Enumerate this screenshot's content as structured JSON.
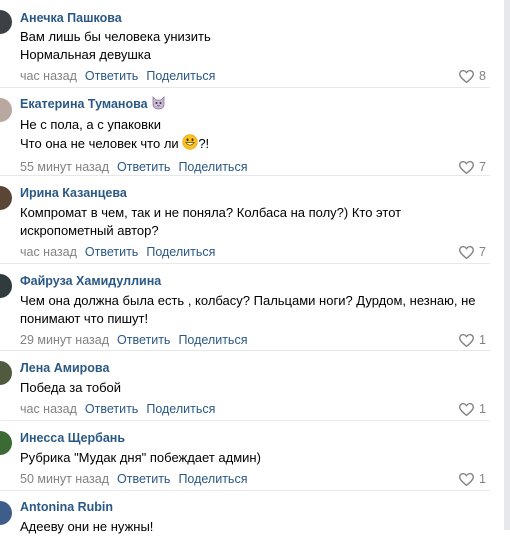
{
  "comments": [
    {
      "author": "Анечка Пашкова",
      "lines": [
        "Вам лишь бы человека унизить",
        "Нормальная девушка"
      ],
      "time": "час назад",
      "reply": "Ответить",
      "share": "Поделиться",
      "likes": "8",
      "avatar_color": "#3b4146"
    },
    {
      "author": "Екатерина Туманова",
      "author_emoji": "cat-face-icon",
      "lines": [
        "Не с пола, а с упаковки",
        "Что она не человек что ли"
      ],
      "line2_suffix": "?!",
      "inline_emoji": "grinning-face-icon",
      "time": "55 минут назад",
      "reply": "Ответить",
      "share": "Поделиться",
      "likes": "7",
      "avatar_color": "#b9a8a0"
    },
    {
      "author": "Ирина Казанцева",
      "lines": [
        "Компромат в чем, так и не поняла? Колбаса на полу?) Кто этот",
        "искропометный автор?"
      ],
      "time": "час назад",
      "reply": "Ответить",
      "share": "Поделиться",
      "likes": "7",
      "avatar_color": "#5a4536"
    },
    {
      "author": "Файруза Хамидуллина",
      "lines": [
        "Чем она должна была есть , колбасу? Пальцами ноги? Дурдом, незнаю, не",
        "понимают что пишут!"
      ],
      "time": "29 минут назад",
      "reply": "Ответить",
      "share": "Поделиться",
      "likes": "1",
      "avatar_color": "#2f3b3d"
    },
    {
      "author": "Лена Амирова",
      "lines": [
        "Победа за тобой"
      ],
      "time": "час назад",
      "reply": "Ответить",
      "share": "Поделиться",
      "likes": "1",
      "avatar_color": "#4f5a3e"
    },
    {
      "author": "Инесса Щербань",
      "lines": [
        "Рубрика \"Мудак дня\" побеждает админ)"
      ],
      "time": "50 минут назад",
      "reply": "Ответить",
      "share": "Поделиться",
      "likes": "1",
      "avatar_color": "#3c6a34"
    },
    {
      "author": "Antonina Rubin",
      "lines": [
        "Адееву они не нужны!"
      ],
      "avatar_color": "#3f5d8a"
    }
  ]
}
